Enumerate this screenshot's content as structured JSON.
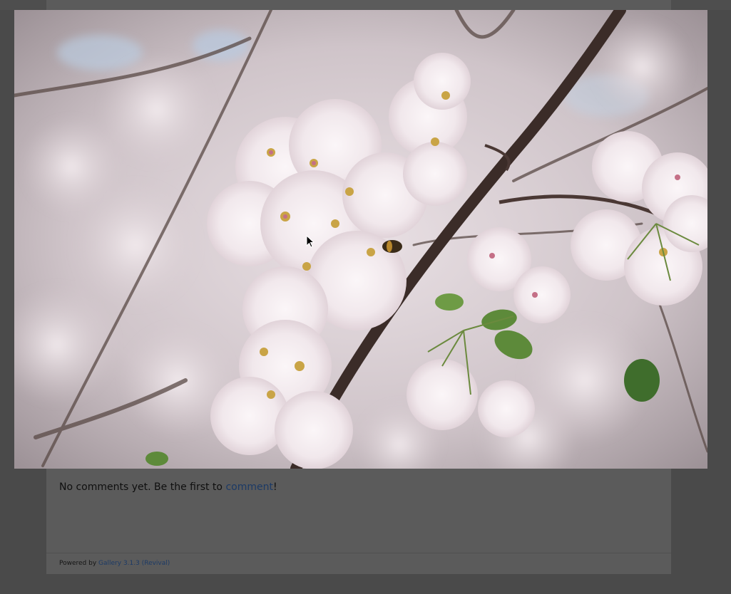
{
  "photo": {
    "alt": "cherry-blossom-photo"
  },
  "comments": {
    "prefix": "No comments yet. Be the first to ",
    "link_label": "comment",
    "suffix": "!"
  },
  "footer": {
    "powered_by": "Powered by ",
    "gallery_link": "Gallery 3.1.3 (Revival)"
  },
  "colors": {
    "background": "#4a4a4a",
    "panel": "#5b5b5b",
    "link": "#1c3a66"
  }
}
